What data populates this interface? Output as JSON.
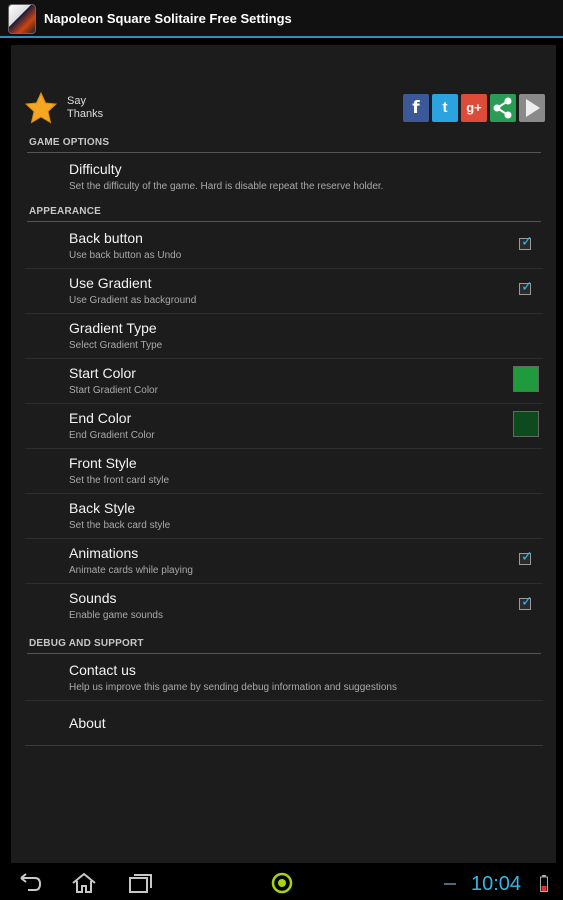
{
  "titlebar": {
    "title": "Napoleon Square Solitaire Free Settings",
    "icon": "app-icon"
  },
  "thanks": {
    "label_line1": "Say",
    "label_line2": "Thanks",
    "icon": "star-icon",
    "share_icons": [
      "facebook-icon",
      "twitter-icon",
      "google-plus-icon",
      "share-icon",
      "play-store-icon"
    ],
    "share_glyphs": {
      "facebook": "f",
      "twitter": "t",
      "google_plus": "g+",
      "share": "<",
      "play": "▶"
    }
  },
  "sections": {
    "game_options": "GAME OPTIONS",
    "appearance": "APPEARANCE",
    "debug": "DEBUG AND SUPPORT"
  },
  "prefs": {
    "difficulty": {
      "title": "Difficulty",
      "summary": "Set the difficulty of the game. Hard is disable repeat the reserve holder."
    },
    "back_button": {
      "title": "Back button",
      "summary": "Use back button as Undo",
      "checked": true
    },
    "use_gradient": {
      "title": "Use Gradient",
      "summary": "Use Gradient as background",
      "checked": true
    },
    "gradient_type": {
      "title": "Gradient Type",
      "summary": "Select Gradient Type"
    },
    "start_color": {
      "title": "Start Color",
      "summary": "Start Gradient Color",
      "color": "#1f9a3c"
    },
    "end_color": {
      "title": "End Color",
      "summary": "End Gradient Color",
      "color": "#0d4a1d"
    },
    "front_style": {
      "title": "Front Style",
      "summary": "Set the front card style"
    },
    "back_style": {
      "title": "Back Style",
      "summary": "Set the back card style"
    },
    "animations": {
      "title": "Animations",
      "summary": "Animate cards while playing",
      "checked": true
    },
    "sounds": {
      "title": "Sounds",
      "summary": "Enable game sounds",
      "checked": true
    },
    "contact": {
      "title": "Contact us",
      "summary": "Help us improve this game by sending debug information and suggestions"
    },
    "about": {
      "title": "About"
    }
  },
  "check_glyph": "✓",
  "navbar": {
    "clock": "10:04",
    "accent": "#33b5e5"
  }
}
